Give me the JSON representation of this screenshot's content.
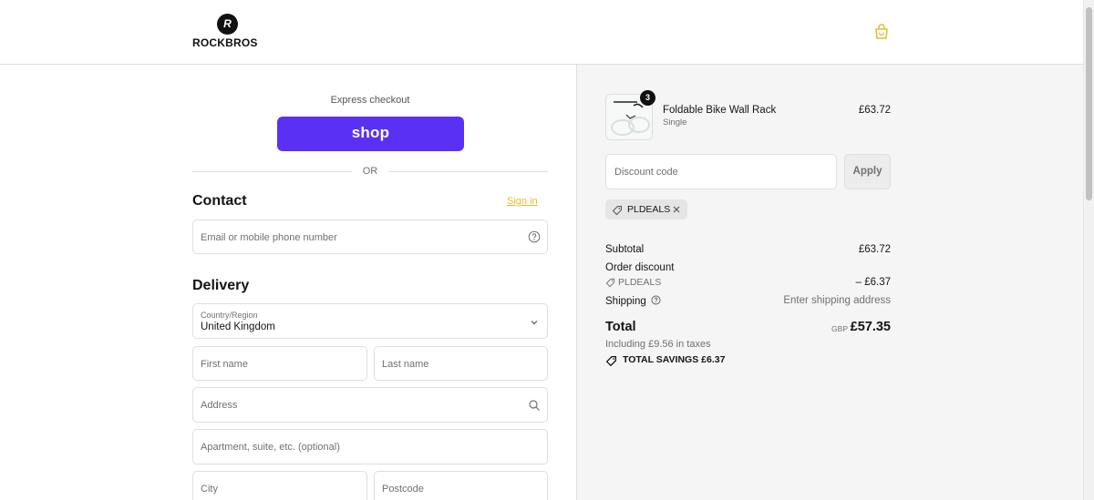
{
  "brand": {
    "name": "ROCKBROS",
    "logo_mark": "R",
    "accent_color": "#e8b92d",
    "shop_pay_color": "#5a31f4"
  },
  "header": {
    "cart_icon": "shopping-bag-icon"
  },
  "express": {
    "label": "Express checkout",
    "shop_button": "shop",
    "divider": "OR"
  },
  "contact": {
    "title": "Contact",
    "sign_in": "Sign in",
    "email_placeholder": "Email or mobile phone number",
    "help_icon": "question-circle-icon"
  },
  "delivery": {
    "title": "Delivery",
    "country_label": "Country/Region",
    "country_value": "United Kingdom",
    "first_name": "First name",
    "last_name": "Last name",
    "address": "Address",
    "apartment": "Apartment, suite, etc. (optional)",
    "city": "City",
    "postcode": "Postcode"
  },
  "summary": {
    "item": {
      "name": "Foldable Bike Wall Rack",
      "variant": "Single",
      "price": "£63.72",
      "quantity": "3"
    },
    "discount_placeholder": "Discount code",
    "apply": "Apply",
    "applied_code": "PLDEALS",
    "subtotal_label": "Subtotal",
    "subtotal_value": "£63.72",
    "order_discount_label": "Order discount",
    "discount_code": "PLDEALS",
    "discount_value": "– £6.37",
    "shipping_label": "Shipping",
    "shipping_value": "Enter shipping address",
    "total_label": "Total",
    "currency": "GBP",
    "total_value": "£57.35",
    "taxes": "Including £9.56 in taxes",
    "savings": "TOTAL SAVINGS  £6.37"
  }
}
